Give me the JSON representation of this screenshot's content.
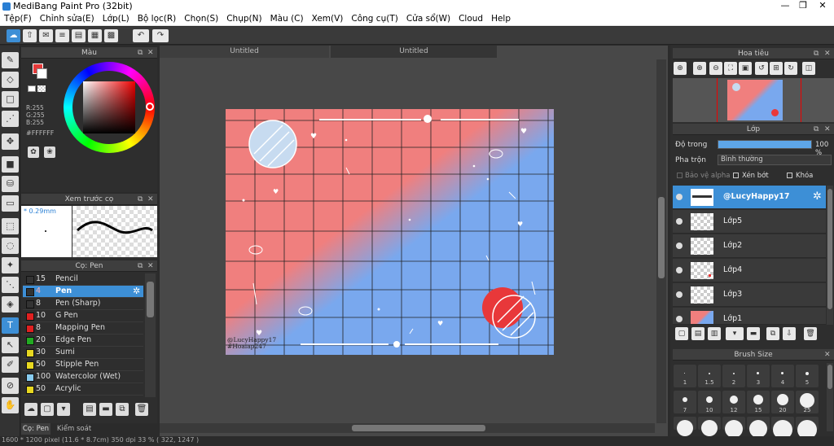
{
  "window": {
    "title": "MediBang Paint Pro (32bit)",
    "controls": [
      "—",
      "❐",
      "✕"
    ]
  },
  "menu": [
    "Tệp(F)",
    "Chỉnh sửa(E)",
    "Lớp(L)",
    "Bộ lọc(R)",
    "Chọn(S)",
    "Chụp(N)",
    "Màu (C)",
    "Xem(V)",
    "Công cụ(T)",
    "Cửa sổ(W)",
    "Cloud",
    "Help"
  ],
  "color_panel": {
    "title": "Màu",
    "r": "R:255",
    "g": "G:255",
    "b": "B:255",
    "hex": "#FFFFFF",
    "primary": "#ffffff",
    "secondary": "#e53a3a"
  },
  "preview_panel": {
    "title": "Xem trước cọ",
    "size": "* 0.29mm"
  },
  "brush_panel": {
    "title": "Cọ: Pen",
    "brushes": [
      {
        "size": "15",
        "name": "Pencil",
        "color": "#333333"
      },
      {
        "size": "4",
        "name": "Pen",
        "color": "#333333"
      },
      {
        "size": "8",
        "name": "Pen (Sharp)",
        "color": "#333333"
      },
      {
        "size": "10",
        "name": "G Pen",
        "color": "#e02020"
      },
      {
        "size": "8",
        "name": "Mapping Pen",
        "color": "#e02020"
      },
      {
        "size": "20",
        "name": "Edge Pen",
        "color": "#22aa22"
      },
      {
        "size": "30",
        "name": "Sumi",
        "color": "#e8d820"
      },
      {
        "size": "50",
        "name": "Stipple Pen",
        "color": "#e8d820"
      },
      {
        "size": "100",
        "name": "Watercolor (Wet)",
        "color": "#88ccf0"
      },
      {
        "size": "50",
        "name": "Acrylic",
        "color": "#e8d820"
      }
    ],
    "bottom_tabs": [
      "Cọ: Pen",
      "Kiểm soát cọ"
    ]
  },
  "canvas": {
    "tabs": [
      "Untitled",
      "Untitled"
    ],
    "watermark_line1": "@LucyHappy17",
    "watermark_line2": "#Hoaiap247"
  },
  "navigator": {
    "title": "Hoa tiêu"
  },
  "layers": {
    "title": "Lớp",
    "opacity_label": "Độ trong",
    "opacity_value": "100 %",
    "opacity_fraction": 1.0,
    "blend_label": "Pha trộn",
    "blend_value": "Bình thường",
    "checks": [
      "Bảo vệ alpha",
      "Xén bớt",
      "Khóa"
    ],
    "items": [
      {
        "name": "@LucyHappy17",
        "selected": true
      },
      {
        "name": "Lớp5",
        "selected": false
      },
      {
        "name": "Lớp2",
        "selected": false
      },
      {
        "name": "Lớp4",
        "selected": false
      },
      {
        "name": "Lớp3",
        "selected": false
      },
      {
        "name": "Lớp1",
        "selected": false
      }
    ]
  },
  "brush_size_panel": {
    "title": "Brush Size",
    "sizes": [
      "1",
      "1.5",
      "2",
      "3",
      "4",
      "5",
      "7",
      "10",
      "12",
      "15",
      "20",
      "25"
    ]
  },
  "status": "1600 * 1200 pixel  (11.6 * 8.7cm)  350 dpi  33 %  ( 322, 1247 )"
}
